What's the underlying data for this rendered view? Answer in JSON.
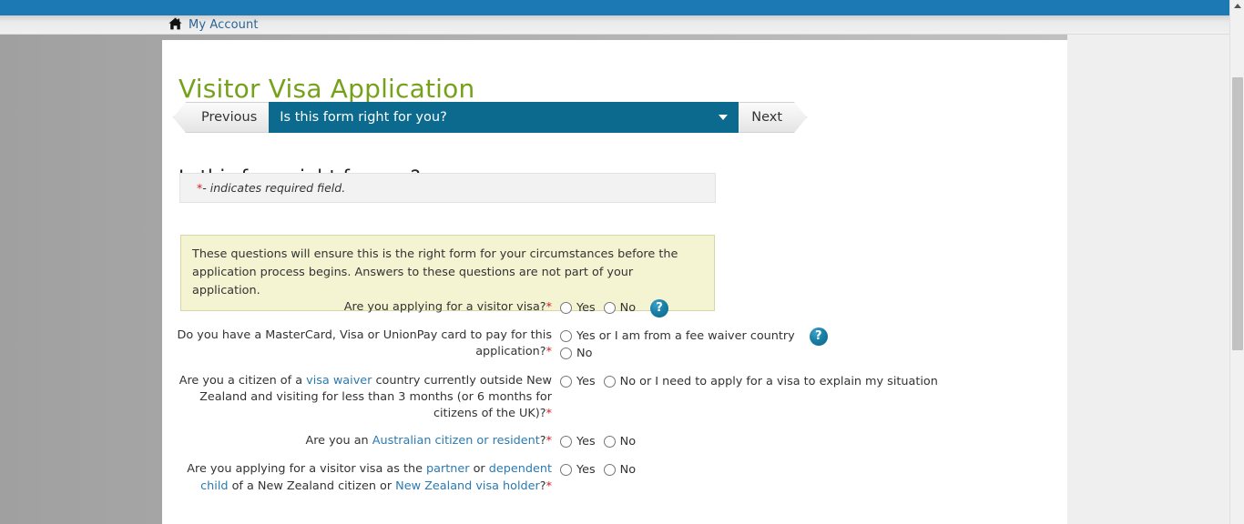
{
  "topbar": {
    "account_label": "My Account",
    "home_icon": "home-icon"
  },
  "page": {
    "title": "Visitor Visa Application",
    "section_heading": "Is this form right for you?"
  },
  "nav": {
    "previous_label": "Previous",
    "next_label": "Next",
    "selected_step": "Is this form right for you?",
    "caret_icon": "chevron-down-icon"
  },
  "required_note": {
    "asterisk": "*",
    "text": " - indicates required field."
  },
  "info_box": {
    "text": "These questions will ensure this is the right form for your circumstances before the application process begins. Answers to these questions are not part of your application."
  },
  "questions": [
    {
      "id": "visitor-visa",
      "label_html": "Are you applying for a visitor visa?",
      "required": "*",
      "options": [
        {
          "label": "Yes",
          "value": "yes"
        },
        {
          "label": "No",
          "value": "no"
        }
      ],
      "has_help": true,
      "help_icon": "help-icon",
      "layout": "inline"
    },
    {
      "id": "payment-card",
      "label_html": "Do you have a MasterCard, Visa or UnionPay card to pay for this application?",
      "required": "*",
      "options": [
        {
          "label": "Yes or I am from a fee waiver country",
          "value": "yes"
        },
        {
          "label": "No",
          "value": "no"
        }
      ],
      "has_help": true,
      "help_icon": "help-icon",
      "layout": "stacked"
    },
    {
      "id": "visa-waiver",
      "label_html": "Are you a citizen of a <a href=\"#\">visa waiver</a> country currently outside New Zealand and visiting for less than 3 months (or 6 months for citizens of the UK)?",
      "required": "*",
      "options": [
        {
          "label": "Yes",
          "value": "yes"
        },
        {
          "label": "No or I need to apply for a visa to explain my situation",
          "value": "no"
        }
      ],
      "has_help": false,
      "layout": "inline"
    },
    {
      "id": "australian-citizen",
      "label_html": "Are you an <a href=\"#\">Australian citizen or resident</a>?",
      "required": "*",
      "options": [
        {
          "label": "Yes",
          "value": "yes"
        },
        {
          "label": "No",
          "value": "no"
        }
      ],
      "has_help": false,
      "layout": "inline"
    },
    {
      "id": "partner-dependent",
      "label_html": "Are you applying for a visitor visa as the <a href=\"#\">partner</a> or <a href=\"#\">dependent child</a> of a New Zealand citizen or <a href=\"#\">New Zealand visa holder</a>?",
      "required": "*",
      "options": [
        {
          "label": "Yes",
          "value": "yes"
        },
        {
          "label": "No",
          "value": "no"
        }
      ],
      "has_help": false,
      "layout": "inline"
    }
  ],
  "colors": {
    "brand_blue": "#1c79b3",
    "teal": "#0b6a8e",
    "title_green": "#76a11b",
    "link_blue": "#2a7ab0",
    "required_red": "#cc2027",
    "info_bg": "#f4f3d2"
  },
  "scrollbar": {
    "up_arrow_icon": "scroll-up-arrow-icon"
  }
}
